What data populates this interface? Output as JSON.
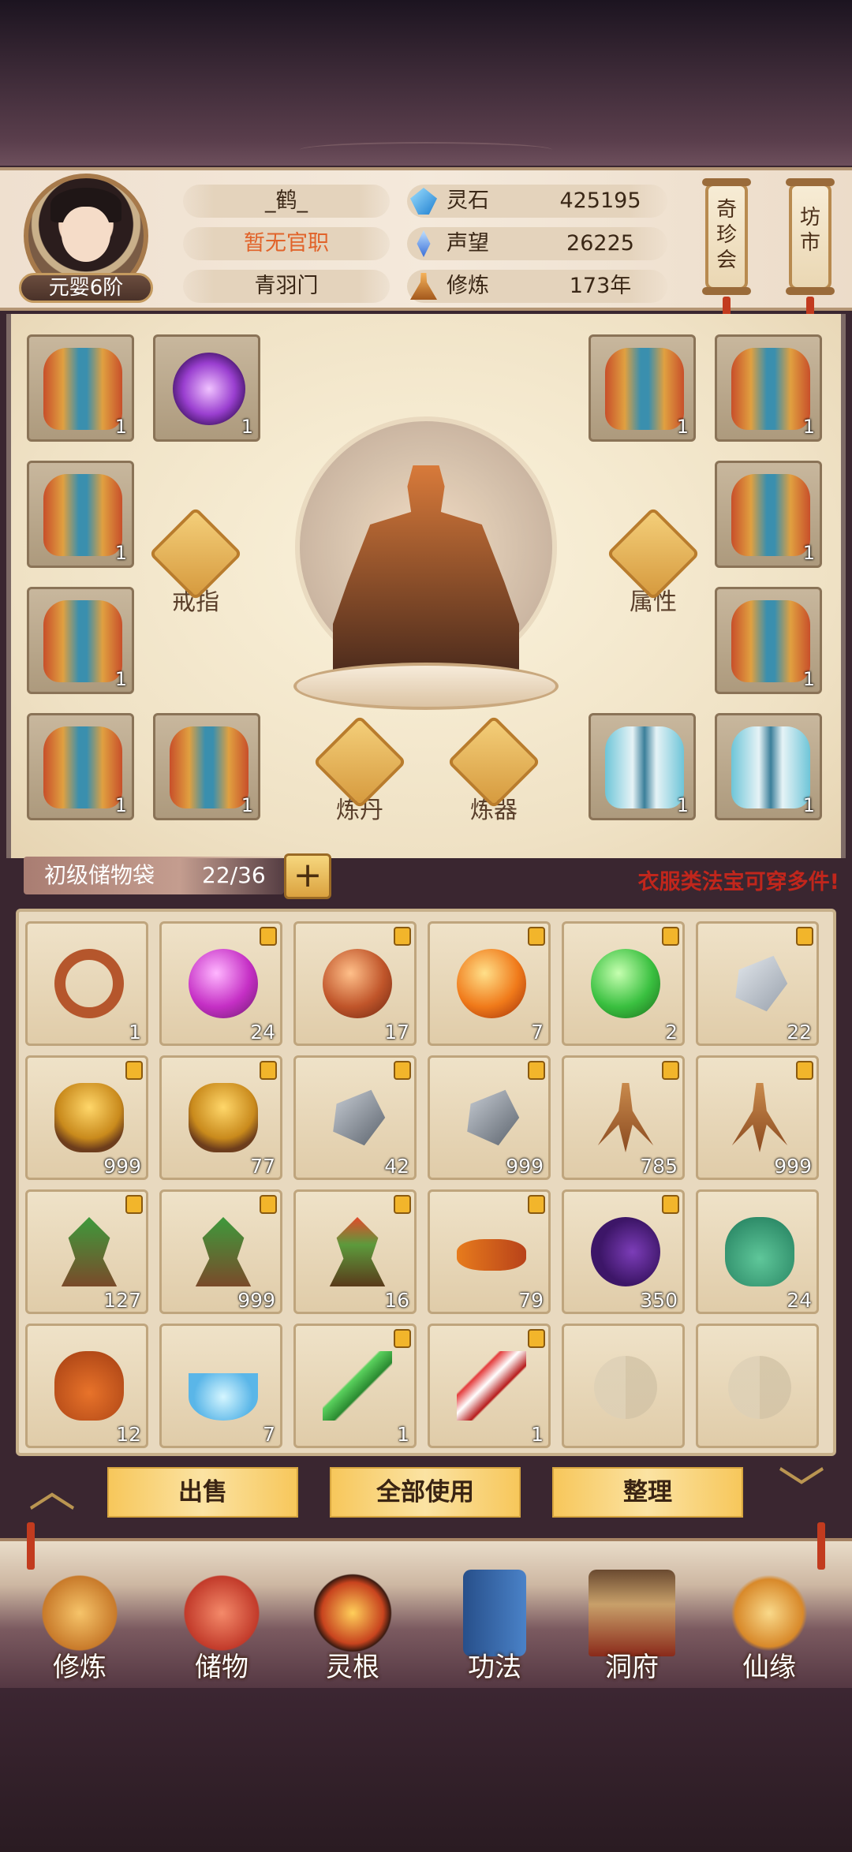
{
  "player": {
    "name": "_鹤_",
    "rank": "元婴6阶",
    "office": "暂无官职",
    "sect": "青羽门"
  },
  "resources": [
    {
      "label": "灵石",
      "value": "425195",
      "icon": "spirit-stone-icon",
      "color": "#3aa0e8"
    },
    {
      "label": "声望",
      "value": "26225",
      "icon": "reputation-icon",
      "color": "#4a7fe0"
    },
    {
      "label": "修炼",
      "value": "173年",
      "icon": "meditation-icon",
      "color": "#d98b3a"
    }
  ],
  "top_buttons": {
    "qizhen": "奇珍会",
    "fangshi": "坊市"
  },
  "equipment": {
    "slots": [
      {
        "item": "armor",
        "count": "1"
      },
      {
        "item": "purple-ring",
        "count": "1"
      },
      {
        "item": "armor",
        "count": "1"
      },
      {
        "item": "armor",
        "count": "1"
      },
      {
        "item": "armor",
        "count": "1"
      },
      {
        "item": "armor",
        "count": "1"
      },
      {
        "item": "armor",
        "count": "1"
      },
      {
        "item": "armor",
        "count": "1"
      },
      {
        "item": "armor",
        "count": "1"
      },
      {
        "item": "armor",
        "count": "1"
      },
      {
        "item": "blue-armor",
        "count": "1"
      },
      {
        "item": "blue-armor",
        "count": "1"
      }
    ],
    "functions": {
      "ring": "戒指",
      "attributes": "属性",
      "alchemy": "炼丹",
      "forging": "炼器"
    }
  },
  "bag": {
    "label": "初级储物袋",
    "count": "22/36",
    "add": "+",
    "note": "衣服类法宝可穿多件!"
  },
  "inventory": [
    {
      "item": "ring",
      "count": "1",
      "locked": false
    },
    {
      "item": "purple-orb",
      "count": "24",
      "locked": true
    },
    {
      "item": "brown-orb",
      "count": "17",
      "locked": true
    },
    {
      "item": "orange-orb",
      "count": "7",
      "locked": true
    },
    {
      "item": "green-orb",
      "count": "2",
      "locked": true
    },
    {
      "item": "silver-ore",
      "count": "22",
      "locked": true
    },
    {
      "item": "gold-ore",
      "count": "999",
      "locked": true
    },
    {
      "item": "gold-ore",
      "count": "77",
      "locked": true
    },
    {
      "item": "iron-ore",
      "count": "42",
      "locked": true
    },
    {
      "item": "iron-ore",
      "count": "999",
      "locked": true
    },
    {
      "item": "ginseng",
      "count": "785",
      "locked": true
    },
    {
      "item": "ginseng",
      "count": "999",
      "locked": true
    },
    {
      "item": "root-herb",
      "count": "127",
      "locked": true
    },
    {
      "item": "root-herb",
      "count": "999",
      "locked": true
    },
    {
      "item": "flower-herb",
      "count": "16",
      "locked": true
    },
    {
      "item": "caterpillar-fungus",
      "count": "79",
      "locked": true
    },
    {
      "item": "berry-branch",
      "count": "350",
      "locked": true
    },
    {
      "item": "green-gourd",
      "count": "24",
      "locked": false
    },
    {
      "item": "orange-gourd",
      "count": "12",
      "locked": false
    },
    {
      "item": "spirit-bowl",
      "count": "7",
      "locked": false
    },
    {
      "item": "jade-sword",
      "count": "1",
      "locked": true
    },
    {
      "item": "red-blade",
      "count": "1",
      "locked": true
    },
    {
      "item": "empty",
      "count": "",
      "locked": false
    },
    {
      "item": "empty",
      "count": "",
      "locked": false
    }
  ],
  "actions": {
    "sell": "出售",
    "use_all": "全部使用",
    "sort": "整理"
  },
  "nav": [
    {
      "label": "修炼",
      "icon": "cultivation-icon",
      "color": "#e8a23a"
    },
    {
      "label": "储物",
      "icon": "storage-bag-icon",
      "color": "#d8553a"
    },
    {
      "label": "灵根",
      "icon": "spirit-root-icon",
      "color": "#c8441e"
    },
    {
      "label": "功法",
      "icon": "scripture-book-icon",
      "color": "#3a6fb8"
    },
    {
      "label": "洞府",
      "icon": "cave-dwelling-icon",
      "color": "#b88a4a"
    },
    {
      "label": "仙缘",
      "icon": "immortal-fate-icon",
      "color": "#e8a23a"
    }
  ]
}
